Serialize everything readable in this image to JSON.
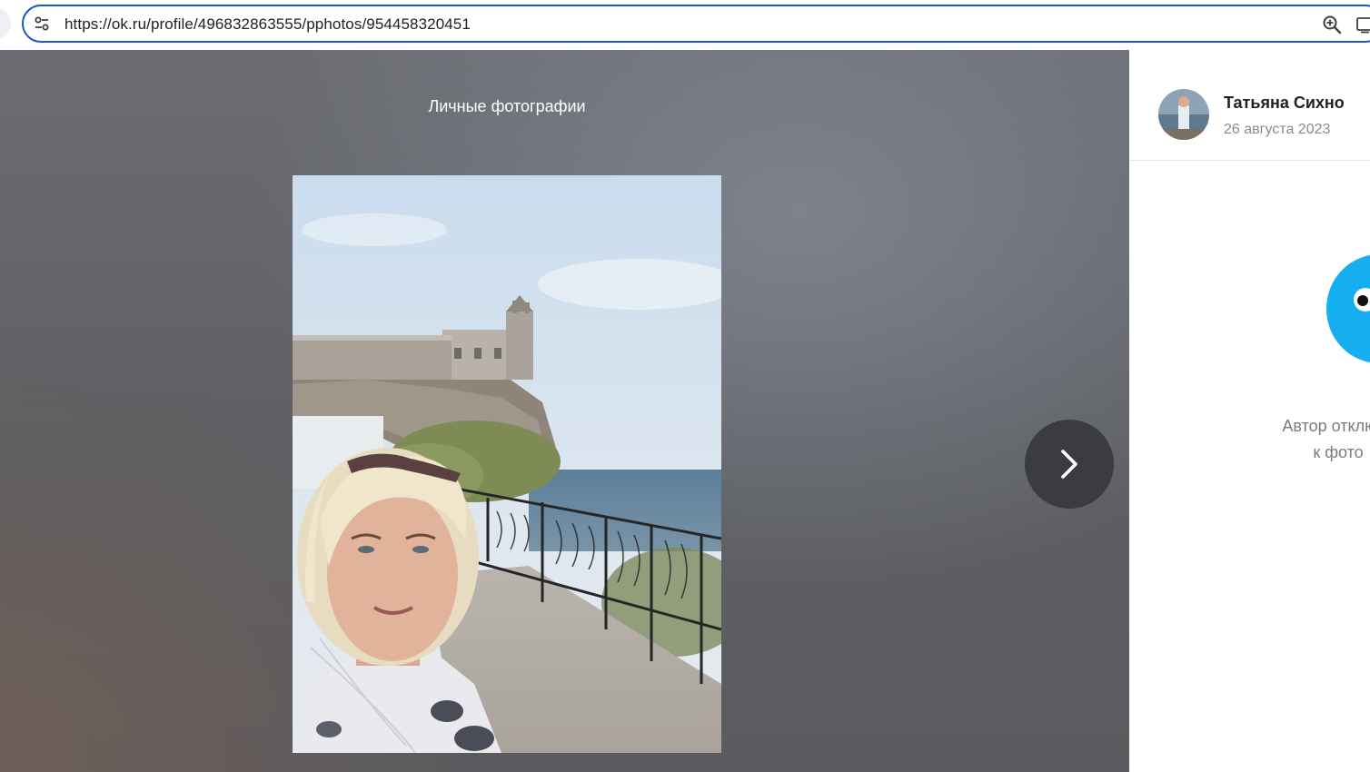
{
  "browser": {
    "url": "https://ok.ru/profile/496832863555/pphotos/954458320451"
  },
  "viewer": {
    "album_title": "Личные фотографии"
  },
  "panel": {
    "author_name": "Татьяна Сихно",
    "post_date": "26 августа 2023",
    "comments_disabled_line1": "Автор отключи",
    "comments_disabled_line2": "к фото"
  },
  "icons": {
    "site_settings": "tune-icon",
    "zoom": "zoom-in-icon",
    "cast": "cast-icon",
    "next": "chevron-right-icon"
  },
  "colors": {
    "omnibox_border": "#1a57c9",
    "next_button": "#3a3c40",
    "mascot_blue": "#15aef0"
  }
}
